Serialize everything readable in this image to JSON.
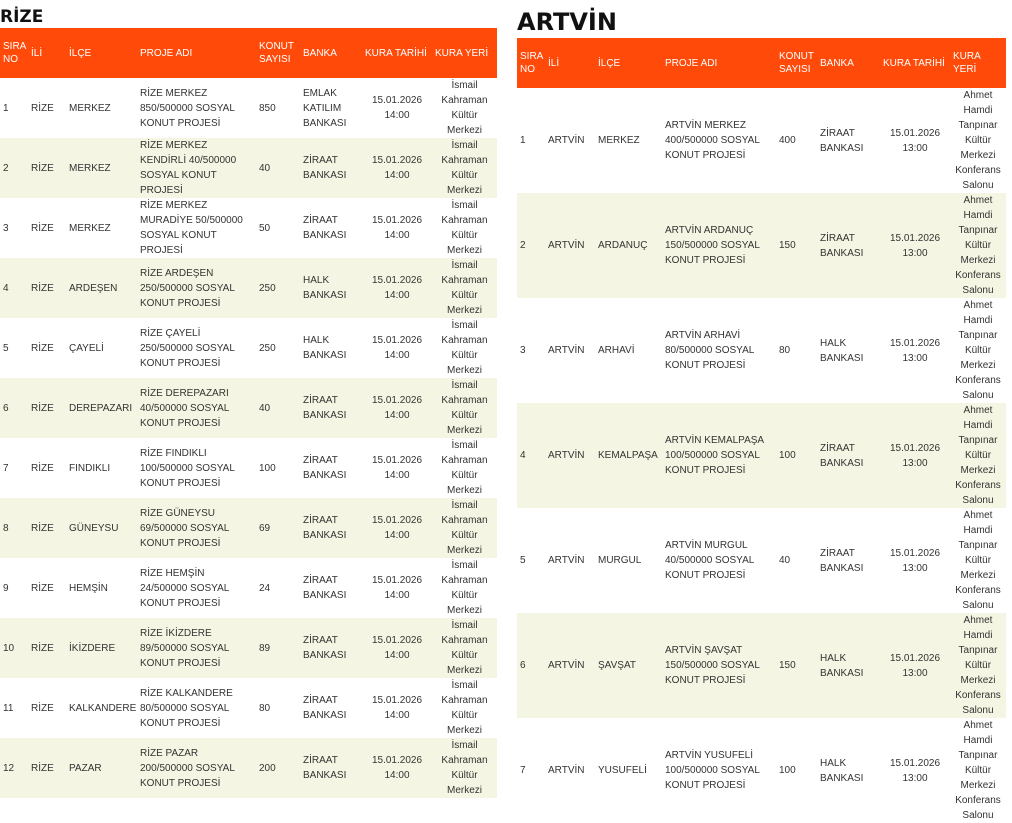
{
  "colors": {
    "header_bg": "#ff4a0a",
    "stripe_bg": "#f5f5e3"
  },
  "sections": [
    {
      "id": "rize",
      "title": "RİZE",
      "headers": [
        "SIRA NO",
        "İLİ",
        "İLÇE",
        "PROJE ADI",
        "KONUT SAYISI",
        "BANKA",
        "KURA TARİHİ",
        "KURA YERİ"
      ],
      "rows": [
        [
          "1",
          "RİZE",
          "MERKEZ",
          "RİZE MERKEZ 850/500000 SOSYAL KONUT PROJESİ",
          "850",
          "EMLAK KATILIM BANKASI",
          "15.01.2026 14:00",
          "İsmail Kahraman Kültür Merkezi"
        ],
        [
          "2",
          "RİZE",
          "MERKEZ",
          "RİZE MERKEZ KENDİRLİ 40/500000 SOSYAL KONUT PROJESİ",
          "40",
          "ZİRAAT BANKASI",
          "15.01.2026 14:00",
          "İsmail Kahraman Kültür Merkezi"
        ],
        [
          "3",
          "RİZE",
          "MERKEZ",
          "RİZE MERKEZ MURADİYE 50/500000 SOSYAL KONUT PROJESİ",
          "50",
          "ZİRAAT BANKASI",
          "15.01.2026 14:00",
          "İsmail Kahraman Kültür Merkezi"
        ],
        [
          "4",
          "RİZE",
          "ARDEŞEN",
          "RİZE ARDEŞEN 250/500000 SOSYAL KONUT PROJESİ",
          "250",
          "HALK BANKASI",
          "15.01.2026 14:00",
          "İsmail Kahraman Kültür Merkezi"
        ],
        [
          "5",
          "RİZE",
          "ÇAYELİ",
          "RİZE ÇAYELİ 250/500000 SOSYAL KONUT PROJESİ",
          "250",
          "HALK BANKASI",
          "15.01.2026 14:00",
          "İsmail Kahraman Kültür Merkezi"
        ],
        [
          "6",
          "RİZE",
          "DEREPAZARI",
          "RİZE DEREPAZARI 40/500000 SOSYAL KONUT PROJESİ",
          "40",
          "ZİRAAT BANKASI",
          "15.01.2026 14:00",
          "İsmail Kahraman Kültür Merkezi"
        ],
        [
          "7",
          "RİZE",
          "FINDIKLI",
          "RİZE FINDIKLI 100/500000 SOSYAL KONUT PROJESİ",
          "100",
          "ZİRAAT BANKASI",
          "15.01.2026 14:00",
          "İsmail Kahraman Kültür Merkezi"
        ],
        [
          "8",
          "RİZE",
          "GÜNEYSU",
          "RİZE GÜNEYSU 69/500000 SOSYAL KONUT PROJESİ",
          "69",
          "ZİRAAT BANKASI",
          "15.01.2026 14:00",
          "İsmail Kahraman Kültür Merkezi"
        ],
        [
          "9",
          "RİZE",
          "HEMŞİN",
          "RİZE HEMŞİN 24/500000 SOSYAL KONUT PROJESİ",
          "24",
          "ZİRAAT BANKASI",
          "15.01.2026 14:00",
          "İsmail Kahraman Kültür Merkezi"
        ],
        [
          "10",
          "RİZE",
          "İKİZDERE",
          "RİZE İKİZDERE 89/500000 SOSYAL KONUT PROJESİ",
          "89",
          "ZİRAAT BANKASI",
          "15.01.2026 14:00",
          "İsmail Kahraman Kültür Merkezi"
        ],
        [
          "11",
          "RİZE",
          "KALKANDERE",
          "RİZE KALKANDERE 80/500000 SOSYAL KONUT PROJESİ",
          "80",
          "ZİRAAT BANKASI",
          "15.01.2026 14:00",
          "İsmail Kahraman Kültür Merkezi"
        ],
        [
          "12",
          "RİZE",
          "PAZAR",
          "RİZE PAZAR 200/500000 SOSYAL KONUT PROJESİ",
          "200",
          "ZİRAAT BANKASI",
          "15.01.2026 14:00",
          "İsmail Kahraman Kültür Merkezi"
        ]
      ]
    },
    {
      "id": "artvin",
      "title": "ARTVİN",
      "headers": [
        "SIRA NO",
        "İLİ",
        "İLÇE",
        "PROJE ADI",
        "KONUT SAYISI",
        "BANKA",
        "KURA TARİHİ",
        "KURA YERİ"
      ],
      "rows": [
        [
          "1",
          "ARTVİN",
          "MERKEZ",
          "ARTVİN MERKEZ 400/500000 SOSYAL KONUT PROJESİ",
          "400",
          "ZİRAAT BANKASI",
          "15.01.2026 13:00",
          "Ahmet Hamdi Tanpınar Kültür Merkezi Konferans Salonu"
        ],
        [
          "2",
          "ARTVİN",
          "ARDANUÇ",
          "ARTVİN ARDANUÇ 150/500000 SOSYAL KONUT PROJESİ",
          "150",
          "ZİRAAT BANKASI",
          "15.01.2026 13:00",
          "Ahmet Hamdi Tanpınar Kültür Merkezi Konferans Salonu"
        ],
        [
          "3",
          "ARTVİN",
          "ARHAVİ",
          "ARTVİN ARHAVİ 80/500000 SOSYAL KONUT PROJESİ",
          "80",
          "HALK BANKASI",
          "15.01.2026 13:00",
          "Ahmet Hamdi Tanpınar Kültür Merkezi Konferans Salonu"
        ],
        [
          "4",
          "ARTVİN",
          "KEMALPAŞA",
          "ARTVİN KEMALPAŞA 100/500000 SOSYAL KONUT PROJESİ",
          "100",
          "ZİRAAT BANKASI",
          "15.01.2026 13:00",
          "Ahmet Hamdi Tanpınar Kültür Merkezi Konferans Salonu"
        ],
        [
          "5",
          "ARTVİN",
          "MURGUL",
          "ARTVİN MURGUL 40/500000 SOSYAL KONUT PROJESİ",
          "40",
          "ZİRAAT BANKASI",
          "15.01.2026 13:00",
          "Ahmet Hamdi Tanpınar Kültür Merkezi Konferans Salonu"
        ],
        [
          "6",
          "ARTVİN",
          "ŞAVŞAT",
          "ARTVİN ŞAVŞAT 150/500000 SOSYAL KONUT PROJESİ",
          "150",
          "HALK BANKASI",
          "15.01.2026 13:00",
          "Ahmet Hamdi Tanpınar Kültür Merkezi Konferans Salonu"
        ],
        [
          "7",
          "ARTVİN",
          "YUSUFELİ",
          "ARTVİN YUSUFELİ 100/500000 SOSYAL KONUT PROJESİ",
          "100",
          "HALK BANKASI",
          "15.01.2026 13:00",
          "Ahmet Hamdi Tanpınar Kültür Merkezi Konferans Salonu"
        ]
      ]
    }
  ]
}
